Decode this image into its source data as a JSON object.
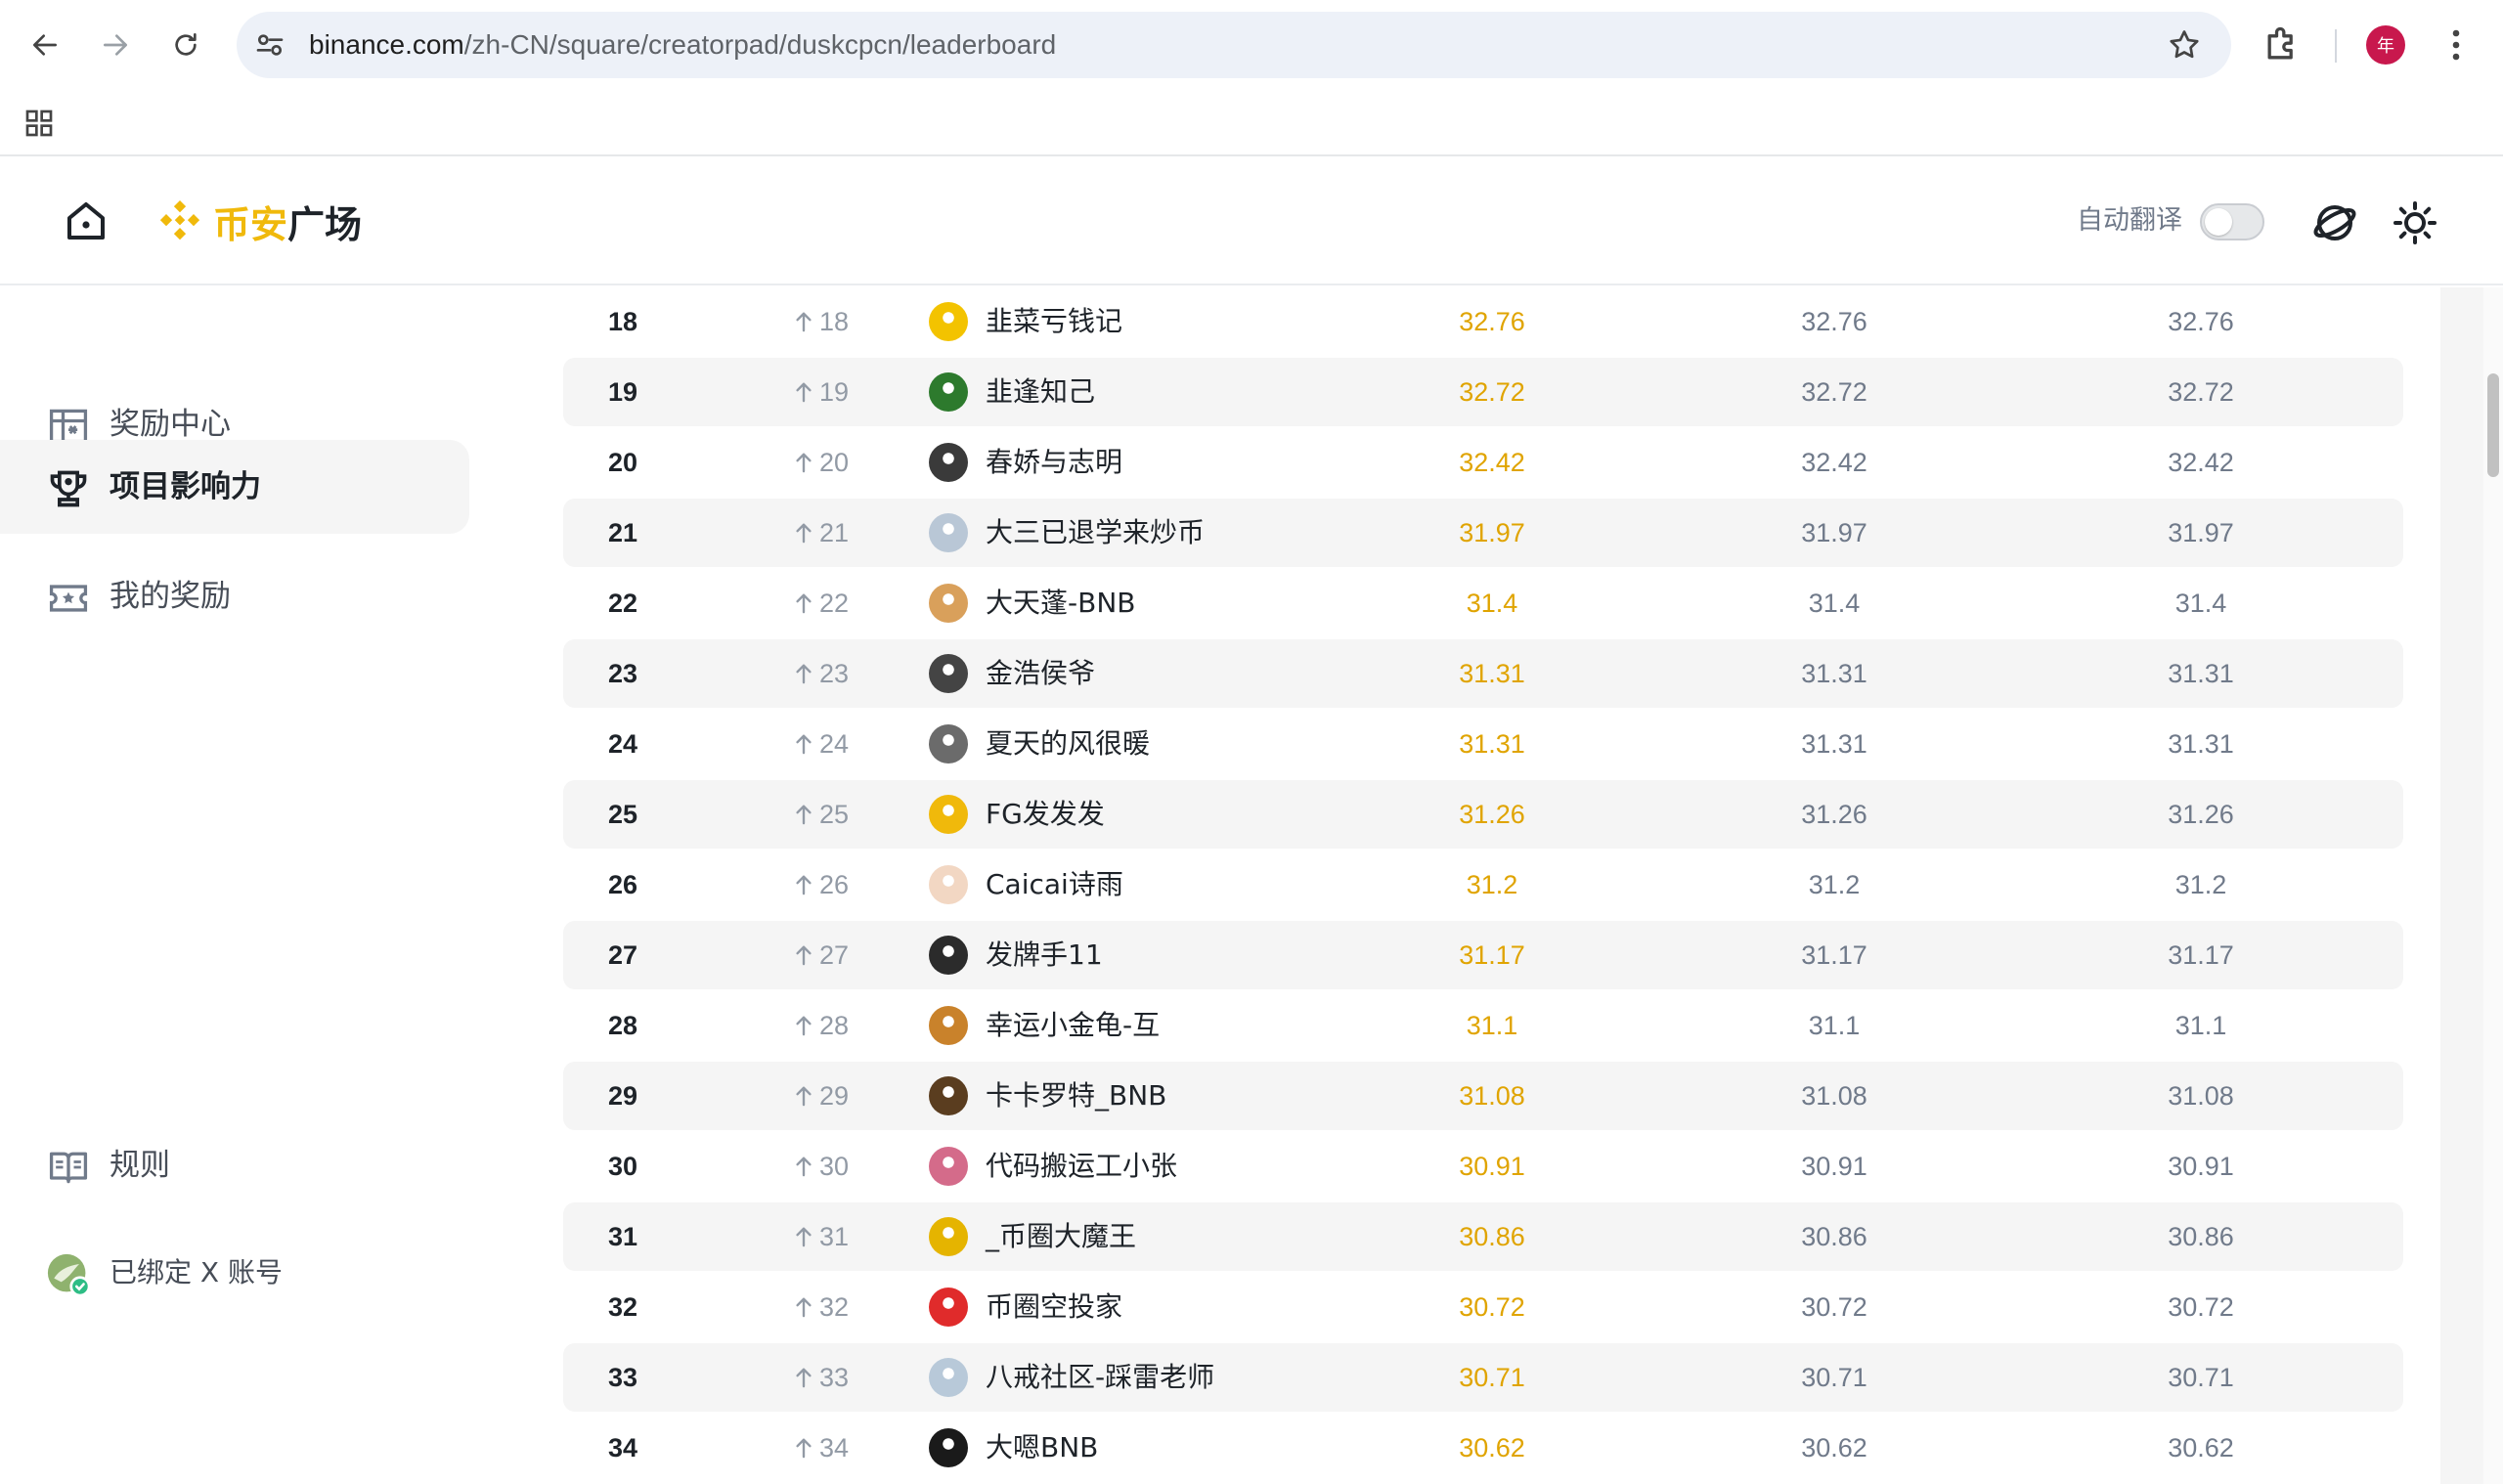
{
  "browser": {
    "url_host": "binance.com",
    "url_path": "/zh-CN/square/creatorpad/duskcpcn/leaderboard",
    "profile_initial": "年"
  },
  "header": {
    "brand_accent": "币安",
    "brand_rest": "广场",
    "auto_translate_label": "自动翻译",
    "auto_translate_on": false
  },
  "sidebar": {
    "items": [
      {
        "label": "奖励中心",
        "icon": "reward-center-icon"
      },
      {
        "label": "项目影响力",
        "icon": "trophy-icon",
        "active": true
      },
      {
        "label": "我的奖励",
        "icon": "ticket-icon"
      }
    ],
    "rules_label": "规则",
    "x_account_label": "已绑定 X 账号"
  },
  "colors": {
    "accent": "#f0b90b",
    "score": "#e0a400",
    "muted": "#707a8a",
    "row_shade": "#f5f5f5"
  },
  "leaderboard": {
    "rows": [
      {
        "rank": "18",
        "change": "18",
        "name": "韭菜亏钱记",
        "score": "32.76",
        "col2": "32.76",
        "col3": "32.76",
        "avatar": "#f3c300"
      },
      {
        "rank": "19",
        "change": "19",
        "name": "韭逢知己",
        "score": "32.72",
        "col2": "32.72",
        "col3": "32.72",
        "avatar": "#2d7a2d"
      },
      {
        "rank": "20",
        "change": "20",
        "name": "春娇与志明",
        "score": "32.42",
        "col2": "32.42",
        "col3": "32.42",
        "avatar": "#3a3a3a"
      },
      {
        "rank": "21",
        "change": "21",
        "name": "大三已退学来炒币",
        "score": "31.97",
        "col2": "31.97",
        "col3": "31.97",
        "avatar": "#b9c7d6"
      },
      {
        "rank": "22",
        "change": "22",
        "name": "大天蓬-BNB",
        "score": "31.4",
        "col2": "31.4",
        "col3": "31.4",
        "avatar": "#d9a05b"
      },
      {
        "rank": "23",
        "change": "23",
        "name": "金浩侯爷",
        "score": "31.31",
        "col2": "31.31",
        "col3": "31.31",
        "avatar": "#444444"
      },
      {
        "rank": "24",
        "change": "24",
        "name": "夏天的风很暖",
        "score": "31.31",
        "col2": "31.31",
        "col3": "31.31",
        "avatar": "#6b6b6b"
      },
      {
        "rank": "25",
        "change": "25",
        "name": "FG发发发",
        "score": "31.26",
        "col2": "31.26",
        "col3": "31.26",
        "avatar": "#f0b90b"
      },
      {
        "rank": "26",
        "change": "26",
        "name": "Caicai诗雨",
        "score": "31.2",
        "col2": "31.2",
        "col3": "31.2",
        "avatar": "#f2d7c3"
      },
      {
        "rank": "27",
        "change": "27",
        "name": "发牌手11",
        "score": "31.17",
        "col2": "31.17",
        "col3": "31.17",
        "avatar": "#2b2b2b"
      },
      {
        "rank": "28",
        "change": "28",
        "name": "幸运小金龟-互",
        "score": "31.1",
        "col2": "31.1",
        "col3": "31.1",
        "avatar": "#c9822b"
      },
      {
        "rank": "29",
        "change": "29",
        "name": "卡卡罗特_BNB",
        "score": "31.08",
        "col2": "31.08",
        "col3": "31.08",
        "avatar": "#5a3d1f"
      },
      {
        "rank": "30",
        "change": "30",
        "name": "代码搬运工小张",
        "score": "30.91",
        "col2": "30.91",
        "col3": "30.91",
        "avatar": "#d46b8a"
      },
      {
        "rank": "31",
        "change": "31",
        "name": "_币圈大魔王",
        "score": "30.86",
        "col2": "30.86",
        "col3": "30.86",
        "avatar": "#e5b400"
      },
      {
        "rank": "32",
        "change": "32",
        "name": "币圈空投家",
        "score": "30.72",
        "col2": "30.72",
        "col3": "30.72",
        "avatar": "#e02b2b"
      },
      {
        "rank": "33",
        "change": "33",
        "name": "八戒社区-踩雷老师",
        "score": "30.71",
        "col2": "30.71",
        "col3": "30.71",
        "avatar": "#b8c9d9"
      },
      {
        "rank": "34",
        "change": "34",
        "name": "大嗯BNB",
        "score": "30.62",
        "col2": "30.62",
        "col3": "30.62",
        "avatar": "#1a1a1a"
      }
    ]
  }
}
